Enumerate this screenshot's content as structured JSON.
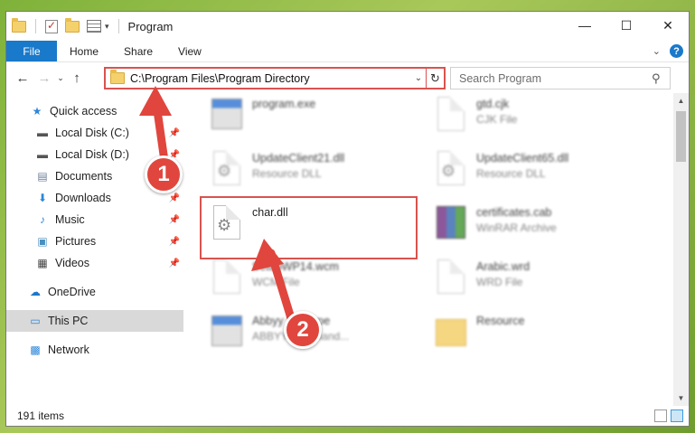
{
  "window": {
    "title": "Program",
    "controls": {
      "minimize": "—",
      "maximize": "☐",
      "close": "✕"
    }
  },
  "ribbon": {
    "tabs": [
      {
        "label": "File",
        "active": true
      },
      {
        "label": "Home"
      },
      {
        "label": "Share"
      },
      {
        "label": "View"
      }
    ],
    "help_label": "?"
  },
  "address": {
    "path": "C:\\Program Files\\Program Directory",
    "refresh_icon": "refresh-icon"
  },
  "search": {
    "placeholder": "Search Program"
  },
  "sidebar": {
    "items": [
      {
        "label": "Quick access",
        "icon": "star-icon"
      },
      {
        "label": "Local Disk (C:)",
        "icon": "drive-icon",
        "pinned": true
      },
      {
        "label": "Local Disk (D:)",
        "icon": "drive-icon",
        "pinned": true
      },
      {
        "label": "Documents",
        "icon": "documents-icon",
        "pinned": true
      },
      {
        "label": "Downloads",
        "icon": "download-icon",
        "pinned": true
      },
      {
        "label": "Music",
        "icon": "music-icon",
        "pinned": true
      },
      {
        "label": "Pictures",
        "icon": "pictures-icon",
        "pinned": true
      },
      {
        "label": "Videos",
        "icon": "videos-icon",
        "pinned": true
      },
      {
        "label": "OneDrive",
        "icon": "cloud-icon"
      },
      {
        "label": "This PC",
        "icon": "computer-icon",
        "selected": true
      },
      {
        "label": "Network",
        "icon": "network-icon"
      }
    ]
  },
  "files": [
    {
      "name": "program.exe",
      "type": "",
      "icon": "exe-icon",
      "blurred": true
    },
    {
      "name": "gtd.cjk",
      "type": "CJK File",
      "icon": "document-icon",
      "blurred": true
    },
    {
      "name": "UpdateClient21.dll",
      "type": "Resource DLL",
      "icon": "dll-icon",
      "blurred": true
    },
    {
      "name": "UpdateClient65.dll",
      "type": "Resource DLL",
      "icon": "dll-icon",
      "blurred": true
    },
    {
      "name": "char.dll",
      "type": "",
      "icon": "dll-icon",
      "blurred": false,
      "highlighted": true
    },
    {
      "name": "certificates.cab",
      "type": "WinRAR Archive",
      "icon": "rar-icon",
      "blurred": true
    },
    {
      "name": "SetupWP14.wcm",
      "type": "WCM File",
      "icon": "document-icon",
      "blurred": true
    },
    {
      "name": "Arabic.wrd",
      "type": "WRD File",
      "icon": "document-icon",
      "blurred": true
    },
    {
      "name": "Abbyy Finetype",
      "type": "ABBYY Font hand...",
      "icon": "exe-icon",
      "blurred": true
    },
    {
      "name": "Resource",
      "type": "",
      "icon": "folder-icon",
      "blurred": true
    }
  ],
  "status": {
    "item_count": "191 items"
  },
  "annotations": {
    "badge_1": "1",
    "badge_2": "2",
    "color": "#e0463d"
  }
}
